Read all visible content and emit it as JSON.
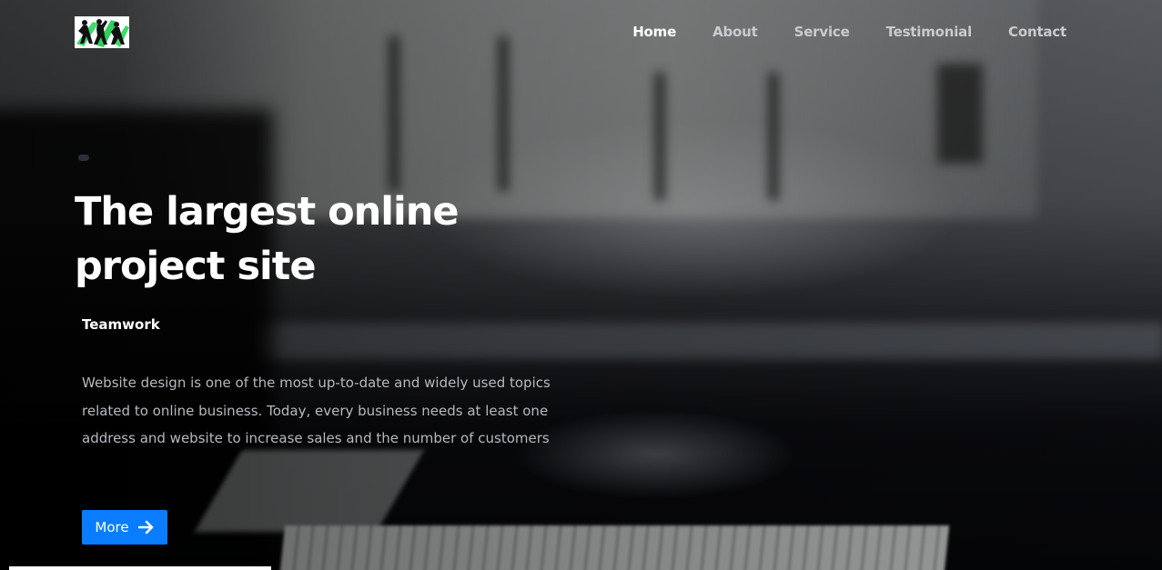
{
  "header": {
    "logo_icon": "teamwork-figures-logo",
    "nav": [
      {
        "label": "Home",
        "active": true
      },
      {
        "label": "About",
        "active": false
      },
      {
        "label": "Service",
        "active": false
      },
      {
        "label": "Testimonial",
        "active": false
      },
      {
        "label": "Contact",
        "active": false
      }
    ]
  },
  "hero": {
    "title": "The largest online project site",
    "subtitle": "Teamwork",
    "description": "Website design is one of the most up-to-date and widely used topics related to online business. Today, every business needs at least one address and website to increase sales and the number of customers",
    "button_label": "More",
    "button_icon": "arrow-right-icon"
  },
  "colors": {
    "accent": "#0a7cff",
    "nav_active": "#ffffff",
    "nav_inactive": "#c9cbcf",
    "description_text": "#b7b9bf"
  }
}
